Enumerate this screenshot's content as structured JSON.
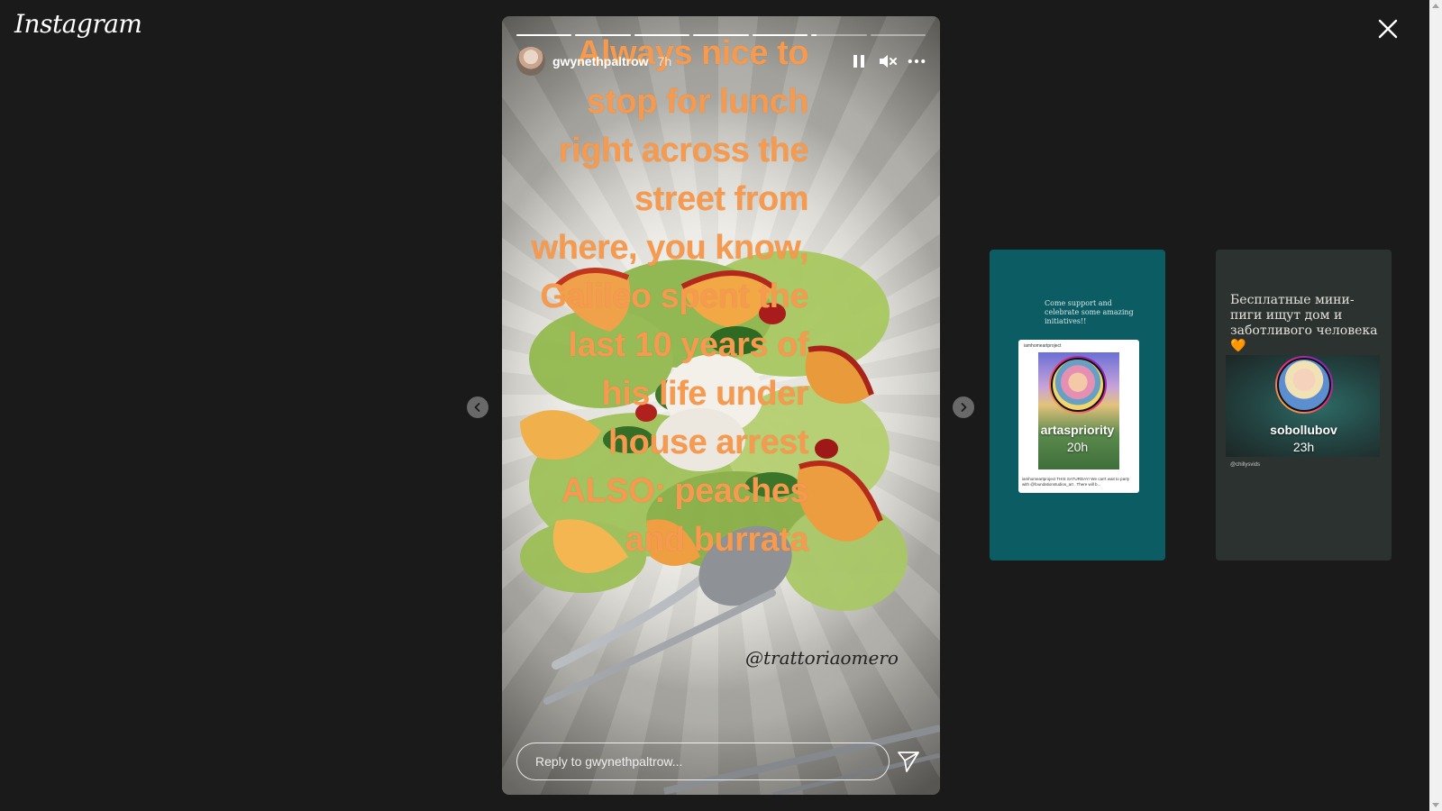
{
  "header": {
    "logo_text": "Instagram",
    "close_icon": "close-icon"
  },
  "story": {
    "username": "gwynethpaltrow",
    "time": "7h",
    "segments_total": 7,
    "segments_complete": 5,
    "current_segment_progress": 0.1,
    "caption_lines": [
      "Always nice to",
      "stop for lunch",
      "right across the",
      "street from",
      "where, you know,",
      "Galileo  spent the",
      "last 10 years of",
      "his life under",
      "house arrest",
      "ALSO:  peaches",
      "and burrata"
    ],
    "caption_color": "#f59a4e",
    "tag": "@trattoriaomero",
    "reply_placeholder": "Reply to gwynethpaltrow...",
    "controls": {
      "pause_icon": "pause-icon",
      "mute_icon": "muted-speaker-icon",
      "more_icon": "more-options-icon",
      "send_icon": "send-icon"
    }
  },
  "navigation": {
    "prev_icon": "chevron-left-icon",
    "next_icon": "chevron-right-icon"
  },
  "previews": [
    {
      "username": "artaspriority",
      "time": "20h",
      "background": "#0c5c64",
      "text": "Come support and celebrate some amazing initiatives!!",
      "poster_header": "iamhomeartproject",
      "poster_footer": "iamhomeartproject THIS SATURDAY! We can't wait to party with @foundationstudios_art . There will b..."
    },
    {
      "username": "sobollubov",
      "time": "23h",
      "background": "#2b3230",
      "text": "Бесплатные мини-пиги ищут дом и заботливого человека🧡",
      "credit": "@chillysvids"
    }
  ]
}
